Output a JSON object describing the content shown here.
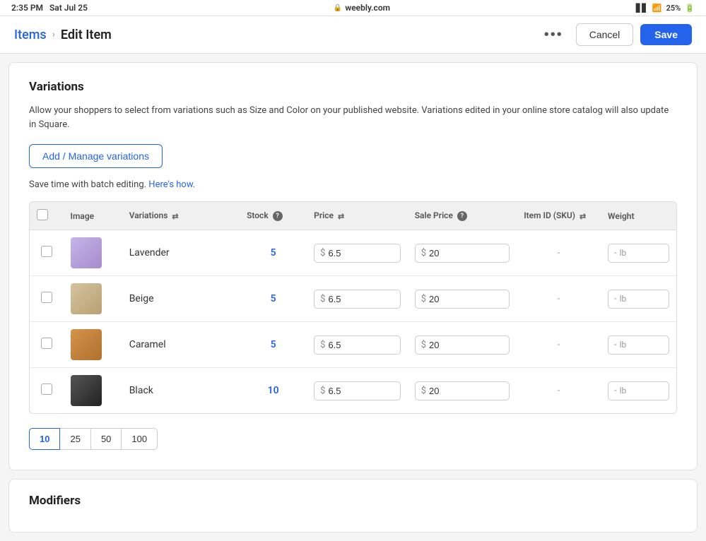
{
  "statusBar": {
    "time": "2:35 PM",
    "date": "Sat Jul 25",
    "url": "weebly.com",
    "signal": "signal-icon",
    "wifi": "wifi-icon",
    "battery": "25%"
  },
  "header": {
    "breadcrumb_link": "Items",
    "breadcrumb_separator": "›",
    "page_title": "Edit Item",
    "more_label": "•••",
    "cancel_label": "Cancel",
    "save_label": "Save"
  },
  "variations": {
    "section_title": "Variations",
    "description": "Allow your shoppers to select from variations such as Size and Color on your published website. Variations edited in your online store catalog will also update in Square.",
    "add_button_label": "Add / Manage variations",
    "batch_edit_text": "Save time with batch editing.",
    "batch_edit_link": "Here's how.",
    "table": {
      "headers": {
        "checkbox": "",
        "image": "Image",
        "variations": "Variations",
        "stock": "Stock",
        "price": "Price",
        "sale_price": "Sale Price",
        "item_id": "Item ID (SKU)",
        "weight": "Weight"
      },
      "rows": [
        {
          "id": 1,
          "name": "Lavender",
          "stock": "5",
          "price": "6.5",
          "sale_price": "20",
          "item_id": "-",
          "weight_value": "-",
          "weight_unit": "lb",
          "image_type": "lavender"
        },
        {
          "id": 2,
          "name": "Beige",
          "stock": "5",
          "price": "6.5",
          "sale_price": "20",
          "item_id": "-",
          "weight_value": "-",
          "weight_unit": "lb",
          "image_type": "beige"
        },
        {
          "id": 3,
          "name": "Caramel",
          "stock": "5",
          "price": "6.5",
          "sale_price": "20",
          "item_id": "-",
          "weight_value": "-",
          "weight_unit": "lb",
          "image_type": "caramel"
        },
        {
          "id": 4,
          "name": "Black",
          "stock": "10",
          "price": "6.5",
          "sale_price": "20",
          "item_id": "-",
          "weight_value": "-",
          "weight_unit": "lb",
          "image_type": "black"
        }
      ]
    },
    "pagination": {
      "options": [
        "10",
        "25",
        "50",
        "100"
      ],
      "active": "10"
    }
  },
  "modifiers": {
    "section_title": "Modifiers"
  },
  "colors": {
    "link_blue": "#2563eb",
    "stock_blue": "#2563eb"
  }
}
